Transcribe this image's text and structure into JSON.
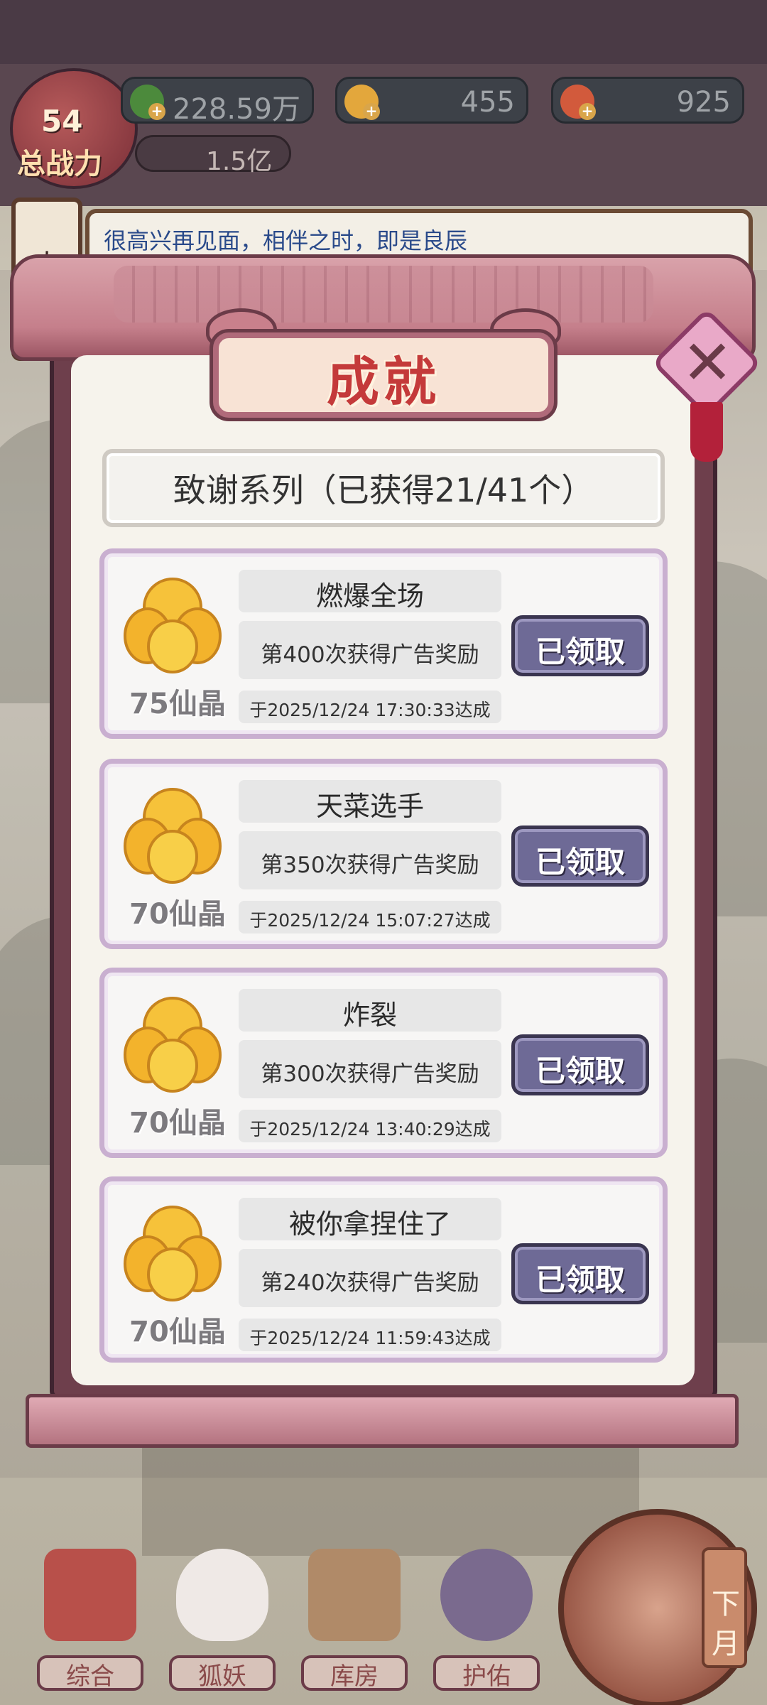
{
  "hud": {
    "power_number": "54",
    "power_label": "总战力",
    "power_value": "1.5亿",
    "currencies": [
      {
        "icon": "leaf-coin-icon",
        "value": "228.59万",
        "color": "#4c8a3c"
      },
      {
        "icon": "gold-crystal-icon",
        "value": "455",
        "color": "#e3a73c"
      },
      {
        "icon": "peach-icon",
        "value": "925",
        "color": "#d25a3c"
      }
    ]
  },
  "side": {
    "event_tab": "大事"
  },
  "message_bar": {
    "text": "很高兴再见面，相伴之时，即是良辰"
  },
  "modal": {
    "title": "成就",
    "close_icon": "close-icon",
    "series_label": "致谢系列（已获得21/41个）",
    "cards": [
      {
        "reward": "75仙晶",
        "name": "燃爆全场",
        "desc": "第400次获得广告奖励",
        "time": "于2025/12/24  17:30:33达成",
        "button": "已领取"
      },
      {
        "reward": "70仙晶",
        "name": "天菜选手",
        "desc": "第350次获得广告奖励",
        "time": "于2025/12/24  15:07:27达成",
        "button": "已领取"
      },
      {
        "reward": "70仙晶",
        "name": "炸裂",
        "desc": "第300次获得广告奖励",
        "time": "于2025/12/24  13:40:29达成",
        "button": "已领取"
      },
      {
        "reward": "70仙晶",
        "name": "被你拿捏住了",
        "desc": "第240次获得广告奖励",
        "time": "于2025/12/24  11:59:43达成",
        "button": "已领取"
      }
    ]
  },
  "bottom_nav": {
    "items": [
      {
        "label": "综合",
        "icon": "shrine-gate-icon"
      },
      {
        "label": "狐妖",
        "icon": "fox-mask-icon"
      },
      {
        "label": "库房",
        "icon": "storehouse-icon"
      },
      {
        "label": "护佑",
        "icon": "lotus-hands-icon"
      }
    ],
    "next_month": "下月"
  },
  "colors": {
    "accent_title": "#c43a3a",
    "claimed_button": "#6e6a96",
    "frame": "#6e3f4c"
  }
}
